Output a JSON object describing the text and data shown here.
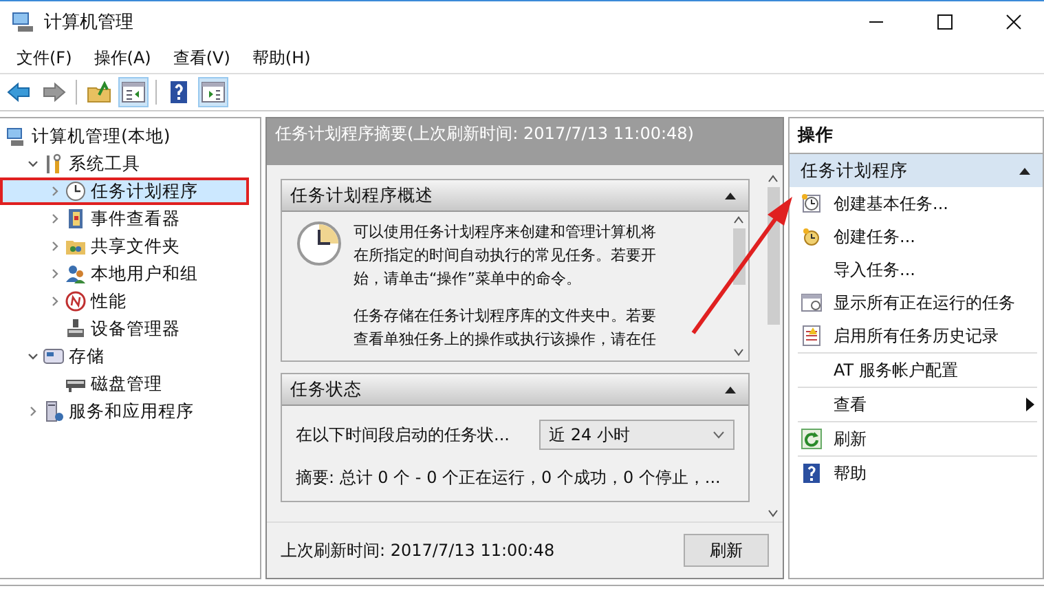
{
  "window": {
    "title": "计算机管理"
  },
  "menu": [
    "文件(F)",
    "操作(A)",
    "查看(V)",
    "帮助(H)"
  ],
  "toolbar": [
    {
      "kind": "back",
      "pressed": false
    },
    {
      "kind": "forward",
      "pressed": false
    },
    {
      "kind": "up",
      "pressed": false
    },
    {
      "kind": "tree-pane",
      "pressed": true
    },
    {
      "kind": "help",
      "pressed": false
    },
    {
      "kind": "action-pane",
      "pressed": true
    }
  ],
  "tree": [
    {
      "label": "计算机管理(本地)",
      "kind": "computer",
      "selected": false,
      "children": [
        {
          "label": "系统工具",
          "kind": "tools",
          "selected": false,
          "expanded": true,
          "children": [
            {
              "label": "任务计划程序",
              "kind": "clock",
              "selected": true,
              "highlighted": true,
              "expanded": false
            },
            {
              "label": "事件查看器",
              "kind": "log",
              "selected": false,
              "highlighted": false,
              "expanded": false
            },
            {
              "label": "共享文件夹",
              "kind": "folder",
              "selected": false,
              "highlighted": false,
              "expanded": false
            },
            {
              "label": "本地用户和组",
              "kind": "users",
              "selected": false,
              "highlighted": false,
              "expanded": false
            },
            {
              "label": "性能",
              "kind": "gauge",
              "selected": false,
              "highlighted": false,
              "expanded": false
            },
            {
              "label": "设备管理器",
              "kind": "device",
              "selected": false,
              "highlighted": false
            }
          ]
        },
        {
          "label": "存储",
          "kind": "storage",
          "selected": false,
          "expanded": true,
          "children": [
            {
              "label": "磁盘管理",
              "kind": "disk",
              "selected": false,
              "highlighted": false
            }
          ]
        },
        {
          "label": "服务和应用程序",
          "kind": "services",
          "selected": false,
          "expanded": false
        }
      ]
    }
  ],
  "summary": {
    "title": "任务计划程序摘要(上次刷新时间: 2017/7/13 11:00:48)",
    "overview": {
      "title": "任务计划程序概述",
      "expanded": true,
      "paragraphs": [
        "可以使用任务计划程序来创建和管理计算机将在所指定的时间自动执行的常见任务。若要开始，请单击“操作”菜单中的命令。",
        "任务存储在任务计划程序库的文件夹中。若要查看单独任务上的操作或执行该操作，请在任"
      ]
    },
    "status": {
      "title": "任务状态",
      "expanded": true,
      "period_label": "在以下时间段启动的任务状...",
      "period": "近 24 小时",
      "summary": "摘要: 总计 0 个 - 0 个正在运行，0 个成功，0 个停止，..."
    },
    "footer": {
      "last_refresh": "上次刷新时间: 2017/7/13 11:00:48",
      "button": "刷新"
    }
  },
  "actions": {
    "title": "操作",
    "section": {
      "title": "任务计划程序",
      "expanded": true
    },
    "groups": [
      [
        {
          "label": "创建基本任务...",
          "kind": "basic-task"
        },
        {
          "label": "创建任务...",
          "kind": "task"
        },
        {
          "label": "导入任务...",
          "kind": "none"
        },
        {
          "label": "显示所有正在运行的任务",
          "kind": "running"
        },
        {
          "label": "启用所有任务历史记录",
          "kind": "history"
        }
      ],
      [
        {
          "label": "AT 服务帐户配置",
          "kind": "none"
        }
      ],
      [
        {
          "label": "查看",
          "kind": "submenu"
        }
      ],
      [
        {
          "label": "刷新",
          "kind": "refresh"
        }
      ],
      [
        {
          "label": "帮助",
          "kind": "help"
        }
      ]
    ]
  }
}
